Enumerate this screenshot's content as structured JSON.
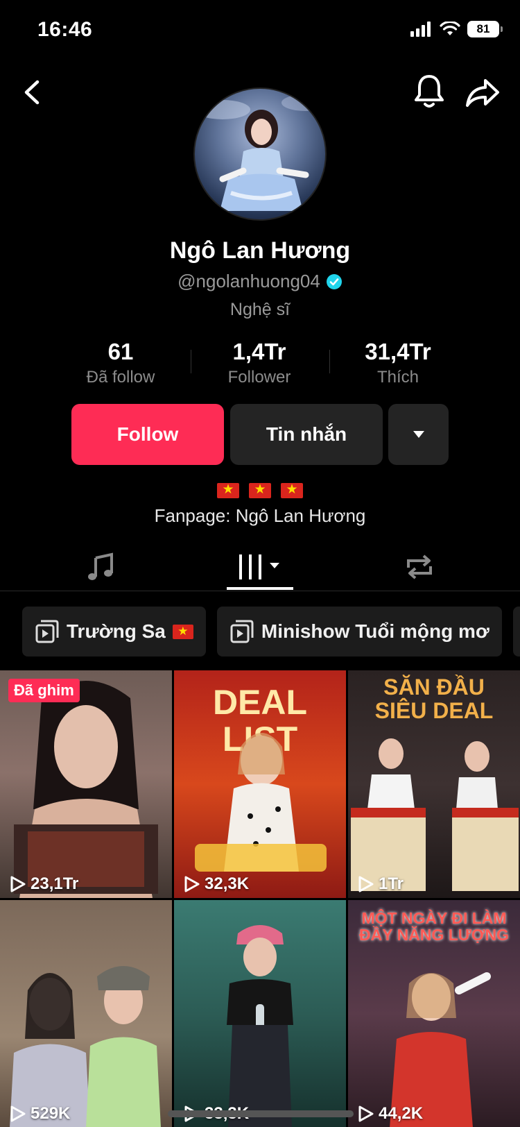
{
  "status_bar": {
    "time": "16:46",
    "battery": "81"
  },
  "profile": {
    "name": "Ngô Lan Hương",
    "handle": "@ngolanhuong04",
    "category": "Nghệ sĩ",
    "bio": "Fanpage: Ngô Lan Hương"
  },
  "stats": [
    {
      "value": "61",
      "label": "Đã follow"
    },
    {
      "value": "1,4Tr",
      "label": "Follower"
    },
    {
      "value": "31,4Tr",
      "label": "Thích"
    }
  ],
  "actions": {
    "follow": "Follow",
    "message": "Tin nhắn"
  },
  "colors": {
    "accent": "#fe2c55",
    "verified": "#20d5ec",
    "background": "#000000"
  },
  "playlists": [
    {
      "label": "Trường Sa"
    },
    {
      "label": "Minishow Tuổi mộng mơ"
    }
  ],
  "videos": [
    {
      "views": "23,1Tr",
      "badge": "Đã ghim"
    },
    {
      "views": "32,3K",
      "overlay": "DEAL LIST"
    },
    {
      "views": "1Tr",
      "overlay": "SĂN ĐẦU SIÊU DEAL"
    },
    {
      "views": "529K"
    },
    {
      "views": "33,3K"
    },
    {
      "views": "44,2K",
      "overlay": "MỘT NGÀY ĐI LÀM ĐẦY NĂNG LƯỢNG"
    }
  ]
}
